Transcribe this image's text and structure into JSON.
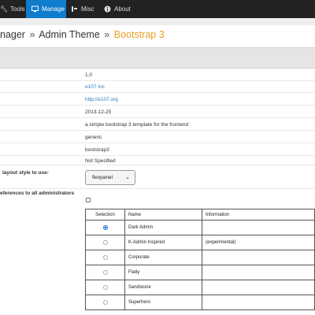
{
  "nav": {
    "items": [
      {
        "label": "Tools",
        "icon": "wrench-icon"
      },
      {
        "label": "Manage",
        "icon": "monitor-icon",
        "active": true
      },
      {
        "label": "Misc",
        "icon": "misc-icon"
      },
      {
        "label": "About",
        "icon": "info-icon"
      }
    ],
    "accent_color": "#0f7ccc"
  },
  "breadcrumb": {
    "part1": "nager",
    "sep": "»",
    "part2": "Admin Theme",
    "current": "Bootstrap 3",
    "current_color": "#e8a020"
  },
  "info": {
    "version": "1.0",
    "author": "e107 Inc",
    "url": "http://e107.org",
    "date": "2013-12-25",
    "description": "a simple bootstrap 3 template for the frontend",
    "category": "generic",
    "folder": "bootstrap3",
    "compatibility": "Not Specified"
  },
  "layout_style": {
    "label": "layout style to use:",
    "selected": "flexpanel"
  },
  "apply_prefs": {
    "label": "eferences to all administrators",
    "checked": false
  },
  "themes_table": {
    "headers": {
      "selection": "Selection",
      "name": "Name",
      "information": "Information"
    },
    "rows": [
      {
        "name": "Dark Admin",
        "info": "",
        "selected": true
      },
      {
        "name": "K-Admin Inspired",
        "info": "(experimental)",
        "selected": false
      },
      {
        "name": "Corporate",
        "info": "",
        "selected": false
      },
      {
        "name": "Flatly",
        "info": "",
        "selected": false
      },
      {
        "name": "Sandstone",
        "info": "",
        "selected": false
      },
      {
        "name": "Superhero",
        "info": "",
        "selected": false
      }
    ]
  }
}
